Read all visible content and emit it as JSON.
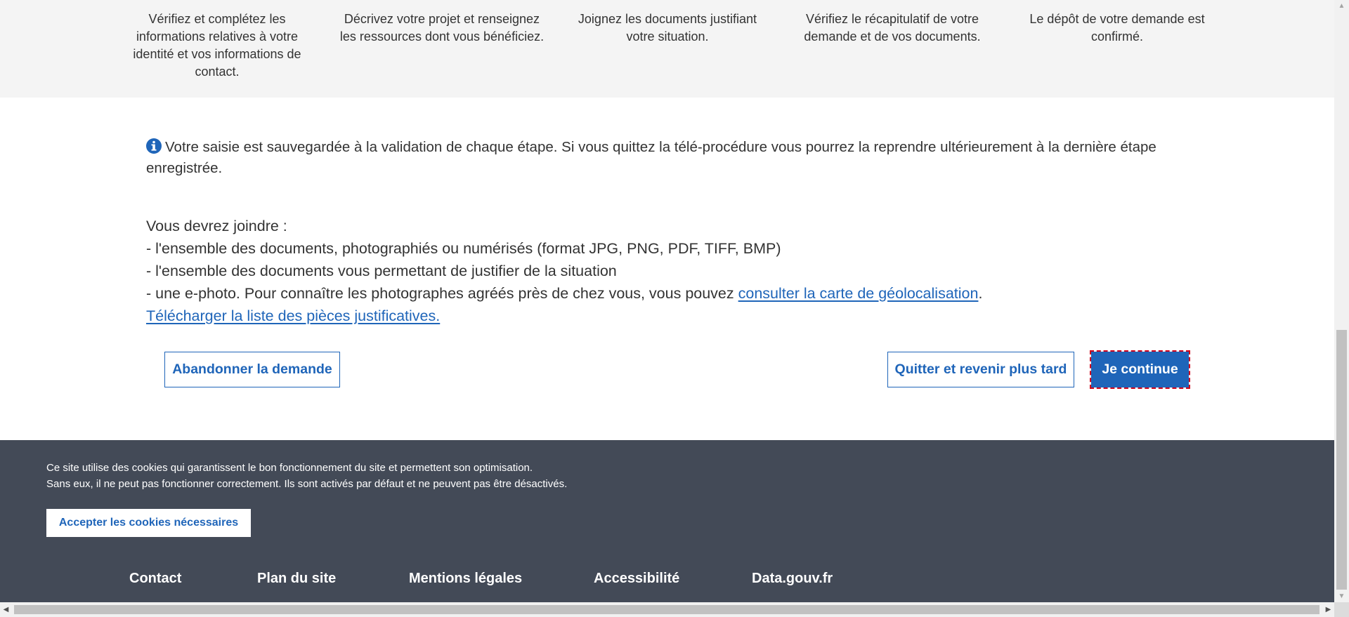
{
  "steps": [
    {
      "description": "Vérifiez et complétez les informations relatives à votre identité et vos informations de contact."
    },
    {
      "description": "Décrivez votre projet et renseignez les ressources dont vous bénéficiez."
    },
    {
      "description": "Joignez les documents justifiant votre situation."
    },
    {
      "description": "Vérifiez le récapitulatif de votre demande et de vos documents."
    },
    {
      "description": "Le dépôt de votre demande est confirmé."
    }
  ],
  "info": {
    "icon": "info-circle-icon",
    "text": "Votre saisie est sauvegardée à la validation de chaque étape. Si vous quittez la télé-procédure vous pourrez la reprendre ultérieurement à la dernière étape enregistrée."
  },
  "documents": {
    "intro": "Vous devrez joindre :",
    "line1": "- l'ensemble des documents, photographiés ou numérisés (format JPG, PNG, PDF, TIFF, BMP)",
    "line2": "- l'ensemble des documents vous permettant de justifier de la situation",
    "line3_prefix": "- une e-photo. Pour connaître les photographes agréés près de chez vous, vous pouvez ",
    "line3_link": "consulter la carte de géolocalisation",
    "line3_suffix": ".",
    "download_link": "Télécharger la liste des pièces justificatives."
  },
  "actions": {
    "abandon": "Abandonner la demande",
    "quit_later": "Quitter et revenir plus tard",
    "continue": "Je continue"
  },
  "cookies": {
    "line1": "Ce site utilise des cookies qui garantissent le bon fonctionnement du site et permettent son optimisation.",
    "line2": "Sans eux, il ne peut pas fonctionner correctement. Ils sont activés par défaut et ne peuvent pas être désactivés.",
    "accept": "Accepter les cookies nécessaires"
  },
  "footer": {
    "links": [
      "Contact",
      "Plan du site",
      "Mentions légales",
      "Accessibilité",
      "Data.gouv.fr"
    ]
  },
  "colors": {
    "accent": "#1f65b9",
    "footer_bg": "#434a57",
    "steps_bg": "#f4f4f4",
    "focus_outline": "#d0021b"
  }
}
